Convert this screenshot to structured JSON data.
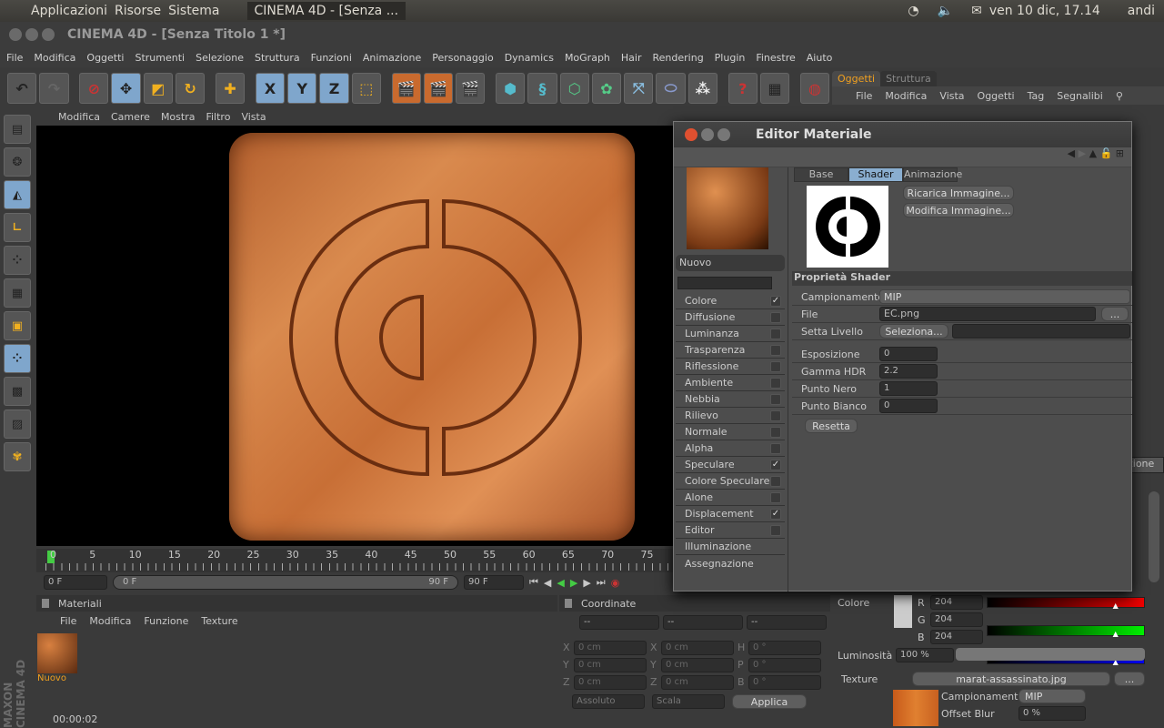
{
  "os_panel": {
    "menus": [
      "Applicazioni",
      "Risorse",
      "Sistema"
    ],
    "active_window": "CINEMA 4D - [Senza ...",
    "clock": "ven 10 dic, 17.14",
    "user": "andi"
  },
  "window": {
    "title": "CINEMA 4D - [Senza Titolo 1 *]"
  },
  "menubar": [
    "File",
    "Modifica",
    "Oggetti",
    "Strumenti",
    "Selezione",
    "Struttura",
    "Funzioni",
    "Animazione",
    "Personaggio",
    "Dynamics",
    "MoGraph",
    "Hair",
    "Rendering",
    "Plugin",
    "Finestre",
    "Aiuto"
  ],
  "toolbar": {
    "axis_labels": [
      "X",
      "Y",
      "Z"
    ]
  },
  "viewport": {
    "menu": [
      "Modifica",
      "Camere",
      "Mostra",
      "Filtro",
      "Vista"
    ]
  },
  "timeline": {
    "ticks": [
      "0",
      "5",
      "10",
      "15",
      "20",
      "25",
      "30",
      "35",
      "40",
      "45",
      "50",
      "55",
      "60",
      "65",
      "70",
      "75"
    ],
    "start": "0 F",
    "range_start": "0 F",
    "range_end": "90 F",
    "end": "90 F"
  },
  "materials": {
    "title": "Materiali",
    "menu": [
      "File",
      "Modifica",
      "Funzione",
      "Texture"
    ],
    "items": [
      {
        "name": "Nuovo"
      }
    ]
  },
  "coordinates": {
    "title": "Coordinate",
    "headers": [
      "--",
      "--",
      "--"
    ],
    "rows": [
      {
        "a": "X",
        "av": "0 cm",
        "b": "X",
        "bv": "0 cm",
        "c": "H",
        "cv": "0 °"
      },
      {
        "a": "Y",
        "av": "0 cm",
        "b": "Y",
        "bv": "0 cm",
        "c": "P",
        "cv": "0 °"
      },
      {
        "a": "Z",
        "av": "0 cm",
        "b": "Z",
        "bv": "0 cm",
        "c": "B",
        "cv": "0 °"
      }
    ],
    "mode1": "Assoluto",
    "mode2": "Scala",
    "apply": "Applica"
  },
  "status": {
    "time": "00:00:02"
  },
  "objects": {
    "tabs": [
      "Oggetti",
      "Struttura"
    ],
    "menu": [
      "File",
      "Modifica",
      "Vista",
      "Oggetti",
      "Tag",
      "Segnalibi"
    ],
    "partial_tab": "zione"
  },
  "editor": {
    "title": "Editor Materiale",
    "material_name": "Nuovo",
    "channels": [
      {
        "label": "Colore",
        "checked": true
      },
      {
        "label": "Diffusione",
        "checked": false
      },
      {
        "label": "Luminanza",
        "checked": false
      },
      {
        "label": "Trasparenza",
        "checked": false
      },
      {
        "label": "Riflessione",
        "checked": false
      },
      {
        "label": "Ambiente",
        "checked": false
      },
      {
        "label": "Nebbia",
        "checked": false
      },
      {
        "label": "Rilievo",
        "checked": false
      },
      {
        "label": "Normale",
        "checked": false
      },
      {
        "label": "Alpha",
        "checked": false
      },
      {
        "label": "Speculare",
        "checked": true
      },
      {
        "label": "Colore Speculare",
        "checked": false
      },
      {
        "label": "Alone",
        "checked": false
      },
      {
        "label": "Displacement",
        "checked": true
      },
      {
        "label": "Editor",
        "checked": false
      }
    ],
    "extra": [
      "Illuminazione",
      "Assegnazione"
    ],
    "tabs": [
      "Base",
      "Shader",
      "Animazione"
    ],
    "active_tab": "Shader",
    "reload": "Ricarica Immagine...",
    "edit": "Modifica Immagine...",
    "section": "Proprietà Shader",
    "sampling_label": "Campionamento",
    "sampling": "MIP",
    "file_label": "File",
    "file": "EC.png",
    "browse": "...",
    "layer_label": "Setta Livello",
    "select": "Seleziona...",
    "params": [
      {
        "label": "Esposizione",
        "value": "0"
      },
      {
        "label": "Gamma HDR",
        "value": "2.2"
      },
      {
        "label": "Punto Nero",
        "value": "1"
      },
      {
        "label": "Punto Bianco",
        "value": "0"
      }
    ],
    "reset": "Resetta"
  },
  "attributes": {
    "color_label": "Colore",
    "r": "204",
    "g": "204",
    "b": "204",
    "rgb_labels": [
      "R",
      "G",
      "B"
    ],
    "brightness_label": "Luminosità",
    "brightness": "100 %",
    "texture_label": "Texture",
    "texture": "marat-assassinato.jpg",
    "browse": "...",
    "sampling_label": "Campionamento",
    "sampling": "MIP",
    "blur_label": "Offset Blur",
    "blur": "0 %",
    "swatch": "#cccccc"
  }
}
